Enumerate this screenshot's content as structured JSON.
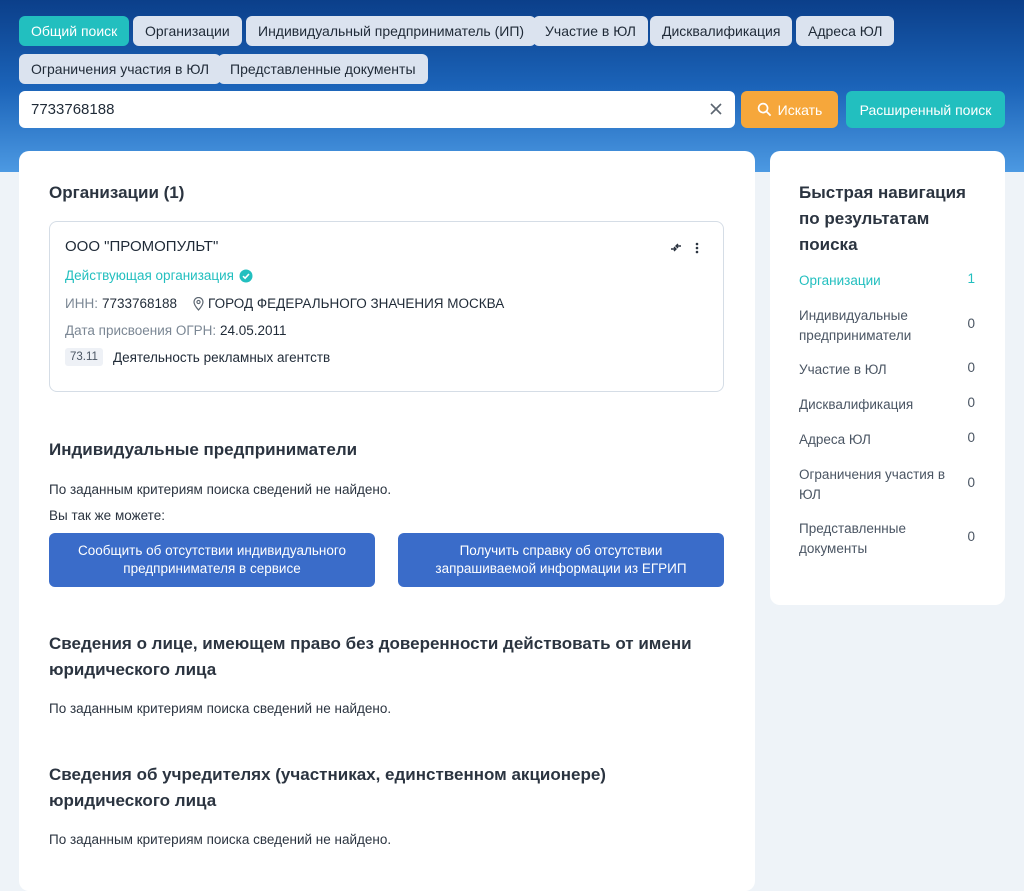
{
  "tabs": [
    {
      "label": "Общий поиск"
    },
    {
      "label": "Организации"
    },
    {
      "label": "Индивидуальный предприниматель (ИП)"
    },
    {
      "label": "Участие в ЮЛ"
    },
    {
      "label": "Дисквалификация"
    },
    {
      "label": "Адреса ЮЛ"
    },
    {
      "label": "Ограничения участия в ЮЛ"
    },
    {
      "label": "Представленные документы"
    }
  ],
  "search": {
    "value": "7733768188",
    "search_button": "Искать",
    "advanced_button": "Расширенный поиск"
  },
  "organizations": {
    "heading": "Организации (1)",
    "card": {
      "name": "ООО \"ПРОМОПУЛЬТ\"",
      "status": "Действующая организация",
      "inn_label": "ИНН:",
      "inn_value": "7733768188",
      "address": "ГОРОД ФЕДЕРАЛЬНОГО ЗНАЧЕНИЯ МОСКВА",
      "ogrn_date_label": "Дата присвоения ОГРН:",
      "ogrn_date_value": "24.05.2011",
      "okved_code": "73.11",
      "okved_name": "Деятельность рекламных агентств"
    }
  },
  "ip_section": {
    "heading": "Индивидуальные предприниматели",
    "not_found": "По заданным критериям поиска сведений не найдено.",
    "also": "Вы так же можете:",
    "btn_report": "Сообщить об отсутствии индивидуального предпринимателя в сервисе",
    "btn_certificate": "Получить справку об отсутствии запрашиваемой информации из ЕГРИП"
  },
  "proxy_section": {
    "heading": "Сведения о лице, имеющем право без доверенности действовать от имени юридического лица",
    "not_found": "По заданным критериям поиска сведений не найдено."
  },
  "founders_section": {
    "heading": "Сведения об учредителях (участниках, единственном акционере) юридического лица",
    "not_found": "По заданным критериям поиска сведений не найдено."
  },
  "quick_nav": {
    "title": "Быстрая навигация по результатам поиска",
    "items": [
      {
        "label": "Организации",
        "count": "1"
      },
      {
        "label": "Индивидуальные предприниматели",
        "count": "0"
      },
      {
        "label": "Участие в ЮЛ",
        "count": "0"
      },
      {
        "label": "Дисквалификация",
        "count": "0"
      },
      {
        "label": "Адреса ЮЛ",
        "count": "0"
      },
      {
        "label": "Ограничения участия в ЮЛ",
        "count": "0"
      },
      {
        "label": "Представленные документы",
        "count": "0"
      }
    ]
  },
  "colors": {
    "accent": "#22bfbf",
    "search_button": "#f6a73b",
    "action_button": "#3a6cc9",
    "header_top": "#0b3f8a"
  }
}
